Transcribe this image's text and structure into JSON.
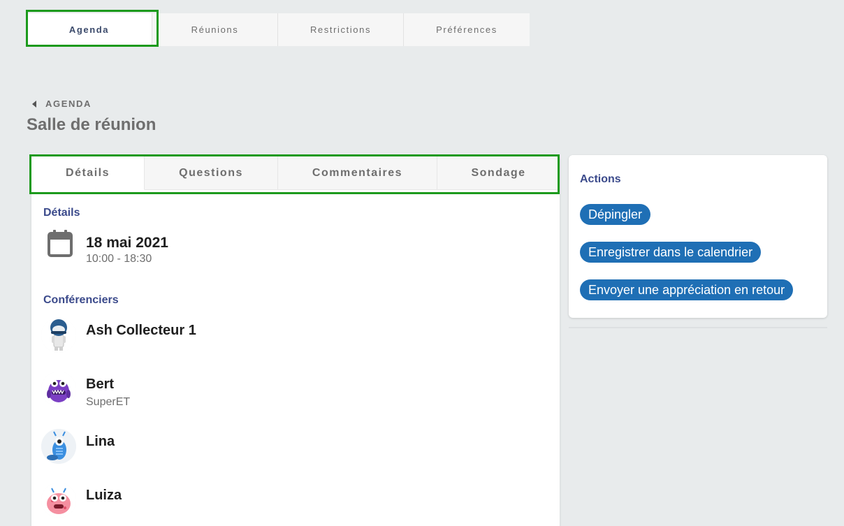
{
  "top_tabs": [
    {
      "label": "Agenda"
    },
    {
      "label": "Réunions"
    },
    {
      "label": "Restrictions"
    },
    {
      "label": "Préférences"
    }
  ],
  "breadcrumb": {
    "label": "AGENDA"
  },
  "page_title": "Salle de réunion",
  "inner_tabs": [
    {
      "label": "Détails"
    },
    {
      "label": "Questions"
    },
    {
      "label": "Commentaires"
    },
    {
      "label": "Sondage"
    }
  ],
  "details": {
    "section_title": "Détails",
    "date": "18 mai 2021",
    "time": "10:00 - 18:30",
    "icon": "calendar-icon"
  },
  "speakers": {
    "section_title": "Conférenciers",
    "items": [
      {
        "name": "Ash Collecteur 1",
        "subtitle": "",
        "avatar": "astronaut-avatar"
      },
      {
        "name": "Bert",
        "subtitle": "SuperET",
        "avatar": "purple-monster-avatar"
      },
      {
        "name": "Lina",
        "subtitle": "",
        "avatar": "blue-monster-avatar"
      },
      {
        "name": "Luiza",
        "subtitle": "",
        "avatar": "pink-monster-avatar"
      }
    ]
  },
  "actions": {
    "title": "Actions",
    "buttons": [
      {
        "label": "Dépingler"
      },
      {
        "label": "Enregistrer dans le calendrier"
      },
      {
        "label": "Envoyer une appréciation en retour"
      }
    ]
  },
  "colors": {
    "accent_blue": "#1f6fb5",
    "section_title": "#3b4a8b",
    "highlight_green": "#1c9a1c",
    "background": "#e8ebec"
  }
}
